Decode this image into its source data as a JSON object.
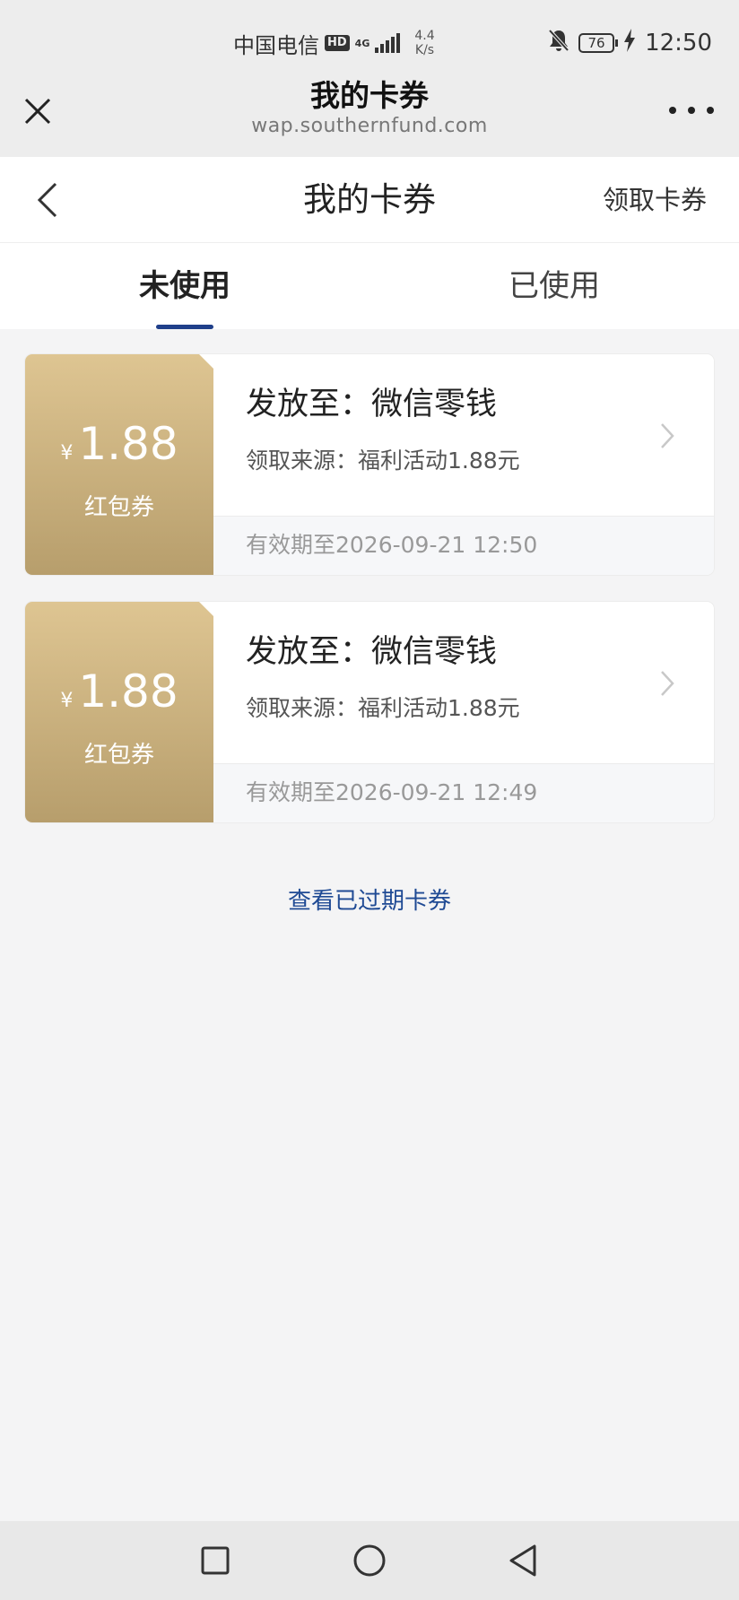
{
  "status_bar": {
    "carrier": "中国电信",
    "hd_label": "HD",
    "network": "4G",
    "speed_value": "4.4",
    "speed_unit": "K/s",
    "battery": "76",
    "time": "12:50"
  },
  "browser": {
    "title": "我的卡券",
    "url": "wap.southernfund.com"
  },
  "header": {
    "title": "我的卡券",
    "claim_label": "领取卡券"
  },
  "tabs": [
    {
      "label": "未使用",
      "active": true
    },
    {
      "label": "已使用",
      "active": false
    }
  ],
  "coupons": [
    {
      "currency": "¥",
      "amount": "1.88",
      "type": "红包券",
      "target": "发放至：微信零钱",
      "source": "领取来源：福利活动1.88元",
      "expiry": "有效期至2026-09-21 12:50"
    },
    {
      "currency": "¥",
      "amount": "1.88",
      "type": "红包券",
      "target": "发放至：微信零钱",
      "source": "领取来源：福利活动1.88元",
      "expiry": "有效期至2026-09-21 12:49"
    }
  ],
  "expired_link_label": "查看已过期卡券",
  "colors": {
    "accent": "#1f3f8a",
    "coupon_gold_top": "#dec592",
    "coupon_gold_bottom": "#b79e6c"
  }
}
